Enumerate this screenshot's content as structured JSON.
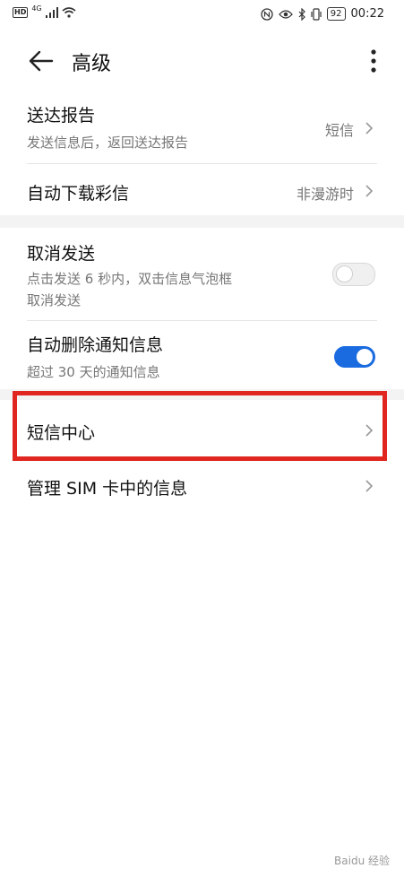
{
  "status_bar": {
    "hd": "HD",
    "network": "4G",
    "battery": "92",
    "time": "00:22"
  },
  "header": {
    "title": "高级"
  },
  "rows": {
    "delivery_report": {
      "title": "送达报告",
      "subtitle": "发送信息后，返回送达报告",
      "value": "短信"
    },
    "auto_download_mms": {
      "title": "自动下载彩信",
      "value": "非漫游时"
    },
    "cancel_send": {
      "title": "取消发送",
      "subtitle_line1": "点击发送 6 秒内，双击信息气泡框",
      "subtitle_line2": "取消发送",
      "enabled": false
    },
    "auto_delete_notices": {
      "title": "自动删除通知信息",
      "subtitle": "超过 30 天的通知信息",
      "enabled": true
    },
    "sms_center": {
      "title": "短信中心"
    },
    "manage_sim_messages": {
      "title": "管理 SIM 卡中的信息"
    }
  },
  "watermark": {
    "text": "Baidu 经验"
  },
  "colors": {
    "accent": "#1a6be0",
    "highlight": "#e0261f"
  }
}
